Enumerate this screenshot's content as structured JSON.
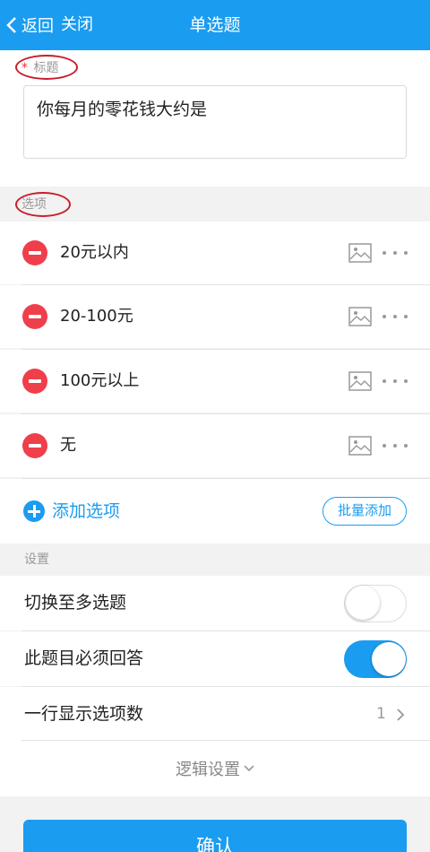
{
  "nav": {
    "back_label": "返回",
    "close_label": "关闭",
    "title": "单选题"
  },
  "title_field": {
    "label": "标题",
    "required_mark": "*",
    "value": "你每月的零花钱大约是"
  },
  "options": {
    "header": "选项",
    "items": [
      {
        "label": "20元以内"
      },
      {
        "label": "20-100元"
      },
      {
        "label": "100元以上"
      },
      {
        "label": "无"
      }
    ],
    "add_label": "添加选项",
    "batch_add_label": "批量添加"
  },
  "settings": {
    "header": "设置",
    "multi_select_label": "切换至多选题",
    "multi_select_on": false,
    "required_label": "此题目必须回答",
    "required_on": true,
    "per_row_label": "一行显示选项数",
    "per_row_value": "1",
    "logic_label": "逻辑设置"
  },
  "confirm_label": "确认",
  "colors": {
    "accent": "#1a9cf0",
    "delete": "#ef3f4b",
    "annotation": "#c81e2a"
  }
}
